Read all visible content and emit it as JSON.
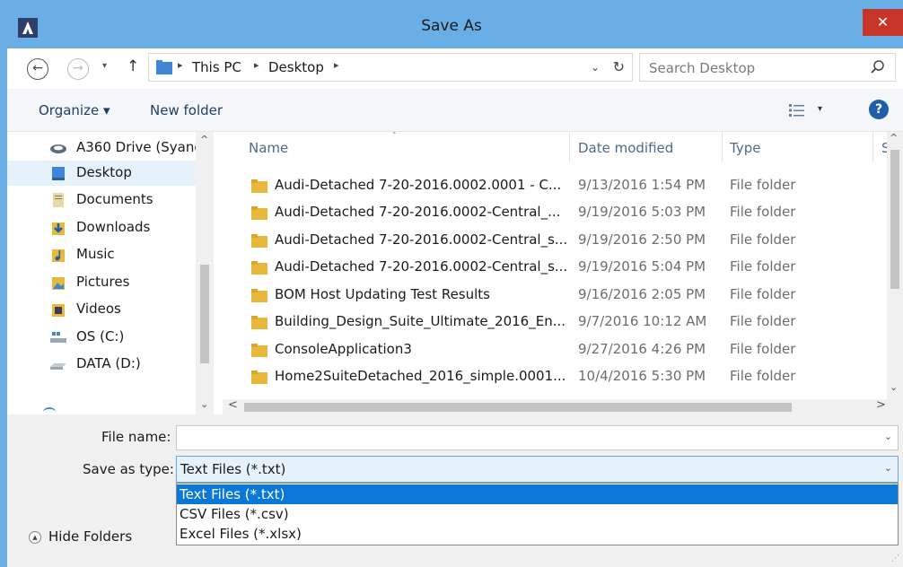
{
  "window": {
    "title": "Save As",
    "close_label": "✕"
  },
  "nav": {
    "back": "←",
    "forward": "→",
    "recent": "▾",
    "up": "↑"
  },
  "address": {
    "sep": "▸",
    "crumbs": [
      "This PC",
      "Desktop"
    ],
    "drop": "⌄",
    "refresh": "↻"
  },
  "search": {
    "placeholder": "Search Desktop"
  },
  "toolbar": {
    "organize": "Organize ▾",
    "new_folder": "New folder",
    "view_drop": "▾",
    "help": "?"
  },
  "navpane": {
    "items": [
      {
        "label": "A360 Drive (Syang",
        "icon": "cloud-drive-icon"
      },
      {
        "label": "Desktop",
        "icon": "desktop-folder-icon",
        "selected": true
      },
      {
        "label": "Documents",
        "icon": "documents-icon"
      },
      {
        "label": "Downloads",
        "icon": "downloads-icon"
      },
      {
        "label": "Music",
        "icon": "music-icon"
      },
      {
        "label": "Pictures",
        "icon": "pictures-icon"
      },
      {
        "label": "Videos",
        "icon": "videos-icon"
      },
      {
        "label": "OS (C:)",
        "icon": "os-drive-icon"
      },
      {
        "label": "DATA (D:)",
        "icon": "data-drive-icon"
      }
    ],
    "scroll_up": "^",
    "scroll_down": "⌄"
  },
  "filelist": {
    "columns": {
      "name": "Name",
      "date": "Date modified",
      "type": "Type",
      "size": "Si"
    },
    "sort_arrow": "˄",
    "rows": [
      {
        "name": "Audi-Detached 7-20-2016.0002.0001 - C...",
        "date": "9/13/2016 1:54 PM",
        "type": "File folder"
      },
      {
        "name": "Audi-Detached 7-20-2016.0002-Central_...",
        "date": "9/19/2016 5:03 PM",
        "type": "File folder"
      },
      {
        "name": "Audi-Detached 7-20-2016.0002-Central_s...",
        "date": "9/19/2016 2:50 PM",
        "type": "File folder"
      },
      {
        "name": "Audi-Detached 7-20-2016.0002-Central_s...",
        "date": "9/19/2016 5:04 PM",
        "type": "File folder"
      },
      {
        "name": "BOM Host Updating Test Results",
        "date": "9/16/2016 2:05 PM",
        "type": "File folder"
      },
      {
        "name": "Building_Design_Suite_Ultimate_2016_En...",
        "date": "9/7/2016 10:12 AM",
        "type": "File folder"
      },
      {
        "name": "ConsoleApplication3",
        "date": "9/27/2016 4:26 PM",
        "type": "File folder"
      },
      {
        "name": "Home2SuiteDetached_2016_simple.0001...",
        "date": "10/4/2016 5:30 PM",
        "type": "File folder"
      }
    ],
    "vscroll_up": "^",
    "vscroll_down": "⌄",
    "hscroll_left": "<",
    "hscroll_right": ">"
  },
  "form": {
    "file_name_label": "File name:",
    "file_name_value": "",
    "save_type_label": "Save as type:",
    "save_type_value": "Text Files (*.txt)",
    "combo_arrow": "⌄",
    "options": [
      "Text Files (*.txt)",
      "CSV Files (*.csv)",
      "Excel Files (*.xlsx)"
    ],
    "selected_option": 0
  },
  "footer": {
    "hide_folders": "Hide Folders",
    "hide_icon": "▲",
    "grip": "⋰"
  },
  "colors": {
    "titlebar": "#6aaee6",
    "close": "#c7352a",
    "selection": "#0b78d7",
    "folder": "#e8b83c"
  }
}
